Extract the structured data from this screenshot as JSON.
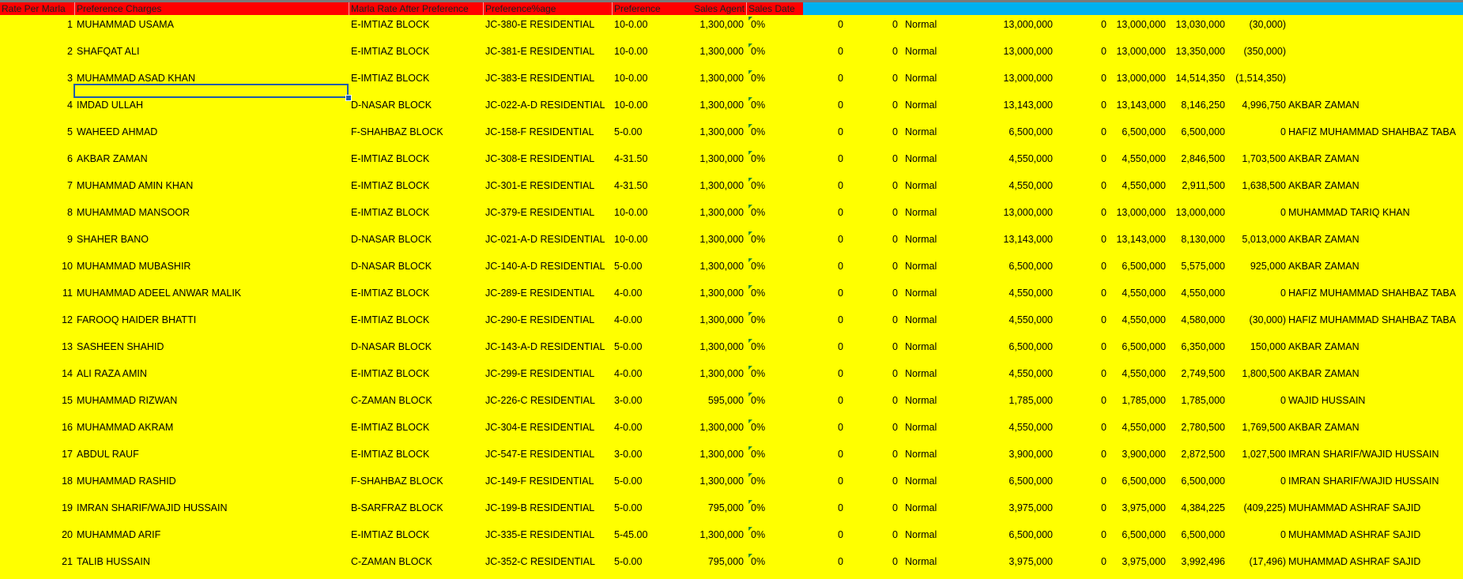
{
  "headers": [
    {
      "key": "rate_per_marla",
      "label": "Rate Per Marla"
    },
    {
      "key": "preference_charges",
      "label": "Preference Charges"
    },
    {
      "key": "marla_rate_after_preference",
      "label": "Marla Rate After Preference"
    },
    {
      "key": "preference_pct",
      "label": "Preference%age"
    },
    {
      "key": "preference",
      "label": "Preference"
    },
    {
      "key": "sales_agent",
      "label": "Sales Agent"
    },
    {
      "key": "sales_date",
      "label": "Sales Date"
    }
  ],
  "colors": {
    "header_red": "#ff0000",
    "header_blue": "#00b0f0",
    "row_fill": "#ffff00",
    "selection_border": "#1f5da8",
    "comment_marker": "#1e8a3a"
  },
  "comment_marker_icon": "comment-indicator-icon",
  "rows": [
    {
      "sr": "1",
      "name": "MUHAMMAD USAMA",
      "block": "E-IMTIAZ BLOCK",
      "plot": "JC-380-E RESIDENTIAL",
      "size": "10-0.00",
      "rate": "1,300,000",
      "pct": "0%",
      "c1": "0",
      "c2": "0",
      "status": "Normal",
      "total": "13,000,000",
      "c3": "0",
      "net": "13,000,000",
      "received": "13,030,000",
      "balance": "(30,000)",
      "agent": ""
    },
    {
      "sr": "2",
      "name": "SHAFQAT ALI",
      "block": "E-IMTIAZ BLOCK",
      "plot": "JC-381-E RESIDENTIAL",
      "size": "10-0.00",
      "rate": "1,300,000",
      "pct": "0%",
      "c1": "0",
      "c2": "0",
      "status": "Normal",
      "total": "13,000,000",
      "c3": "0",
      "net": "13,000,000",
      "received": "13,350,000",
      "balance": "(350,000)",
      "agent": ""
    },
    {
      "sr": "3",
      "name": "MUHAMMAD ASAD KHAN",
      "block": "E-IMTIAZ BLOCK",
      "plot": "JC-383-E RESIDENTIAL",
      "size": "10-0.00",
      "rate": "1,300,000",
      "pct": "0%",
      "c1": "0",
      "c2": "0",
      "status": "Normal",
      "total": "13,000,000",
      "c3": "0",
      "net": "13,000,000",
      "received": "14,514,350",
      "balance": "(1,514,350)",
      "agent": ""
    },
    {
      "sr": "4",
      "name": "IMDAD ULLAH",
      "block": "D-NASAR BLOCK",
      "plot": "JC-022-A-D RESIDENTIAL",
      "size": "10-0.00",
      "rate": "1,300,000",
      "pct": "0%",
      "c1": "0",
      "c2": "0",
      "status": "Normal",
      "total": "13,143,000",
      "c3": "0",
      "net": "13,143,000",
      "received": "8,146,250",
      "balance": "4,996,750",
      "agent": "AKBAR ZAMAN"
    },
    {
      "sr": "5",
      "name": "WAHEED AHMAD",
      "block": "F-SHAHBAZ BLOCK",
      "plot": "JC-158-F RESIDENTIAL",
      "size": "5-0.00",
      "rate": "1,300,000",
      "pct": "0%",
      "c1": "0",
      "c2": "0",
      "status": "Normal",
      "total": "6,500,000",
      "c3": "0",
      "net": "6,500,000",
      "received": "6,500,000",
      "balance": "0",
      "agent": "HAFIZ MUHAMMAD SHAHBAZ TABA"
    },
    {
      "sr": "6",
      "name": "AKBAR ZAMAN",
      "block": "E-IMTIAZ BLOCK",
      "plot": "JC-308-E RESIDENTIAL",
      "size": "4-31.50",
      "rate": "1,300,000",
      "pct": "0%",
      "c1": "0",
      "c2": "0",
      "status": "Normal",
      "total": "4,550,000",
      "c3": "0",
      "net": "4,550,000",
      "received": "2,846,500",
      "balance": "1,703,500",
      "agent": "AKBAR ZAMAN"
    },
    {
      "sr": "7",
      "name": "MUHAMMAD AMIN KHAN",
      "block": "E-IMTIAZ BLOCK",
      "plot": "JC-301-E RESIDENTIAL",
      "size": "4-31.50",
      "rate": "1,300,000",
      "pct": "0%",
      "c1": "0",
      "c2": "0",
      "status": "Normal",
      "total": "4,550,000",
      "c3": "0",
      "net": "4,550,000",
      "received": "2,911,500",
      "balance": "1,638,500",
      "agent": "AKBAR ZAMAN"
    },
    {
      "sr": "8",
      "name": "MUHAMMAD MANSOOR",
      "block": "E-IMTIAZ BLOCK",
      "plot": "JC-379-E RESIDENTIAL",
      "size": "10-0.00",
      "rate": "1,300,000",
      "pct": "0%",
      "c1": "0",
      "c2": "0",
      "status": "Normal",
      "total": "13,000,000",
      "c3": "0",
      "net": "13,000,000",
      "received": "13,000,000",
      "balance": "0",
      "agent": "MUHAMMAD TARIQ KHAN"
    },
    {
      "sr": "9",
      "name": "SHAHER BANO",
      "block": "D-NASAR BLOCK",
      "plot": "JC-021-A-D RESIDENTIAL",
      "size": "10-0.00",
      "rate": "1,300,000",
      "pct": "0%",
      "c1": "0",
      "c2": "0",
      "status": "Normal",
      "total": "13,143,000",
      "c3": "0",
      "net": "13,143,000",
      "received": "8,130,000",
      "balance": "5,013,000",
      "agent": "AKBAR ZAMAN"
    },
    {
      "sr": "10",
      "name": "MUHAMMAD MUBASHIR",
      "block": "D-NASAR BLOCK",
      "plot": "JC-140-A-D RESIDENTIAL",
      "size": "5-0.00",
      "rate": "1,300,000",
      "pct": "0%",
      "c1": "0",
      "c2": "0",
      "status": "Normal",
      "total": "6,500,000",
      "c3": "0",
      "net": "6,500,000",
      "received": "5,575,000",
      "balance": "925,000",
      "agent": "AKBAR ZAMAN"
    },
    {
      "sr": "11",
      "name": "MUHAMMAD ADEEL ANWAR MALIK",
      "block": "E-IMTIAZ BLOCK",
      "plot": "JC-289-E RESIDENTIAL",
      "size": "4-0.00",
      "rate": "1,300,000",
      "pct": "0%",
      "c1": "0",
      "c2": "0",
      "status": "Normal",
      "total": "4,550,000",
      "c3": "0",
      "net": "4,550,000",
      "received": "4,550,000",
      "balance": "0",
      "agent": "HAFIZ MUHAMMAD SHAHBAZ TABA"
    },
    {
      "sr": "12",
      "name": "FAROOQ HAIDER BHATTI",
      "block": "E-IMTIAZ BLOCK",
      "plot": "JC-290-E RESIDENTIAL",
      "size": "4-0.00",
      "rate": "1,300,000",
      "pct": "0%",
      "c1": "0",
      "c2": "0",
      "status": "Normal",
      "total": "4,550,000",
      "c3": "0",
      "net": "4,550,000",
      "received": "4,580,000",
      "balance": "(30,000)",
      "agent": "HAFIZ MUHAMMAD SHAHBAZ TABA"
    },
    {
      "sr": "13",
      "name": "SASHEEN SHAHID",
      "block": "D-NASAR BLOCK",
      "plot": "JC-143-A-D RESIDENTIAL",
      "size": "5-0.00",
      "rate": "1,300,000",
      "pct": "0%",
      "c1": "0",
      "c2": "0",
      "status": "Normal",
      "total": "6,500,000",
      "c3": "0",
      "net": "6,500,000",
      "received": "6,350,000",
      "balance": "150,000",
      "agent": "AKBAR ZAMAN"
    },
    {
      "sr": "14",
      "name": "ALI RAZA AMIN",
      "block": "E-IMTIAZ BLOCK",
      "plot": "JC-299-E RESIDENTIAL",
      "size": "4-0.00",
      "rate": "1,300,000",
      "pct": "0%",
      "c1": "0",
      "c2": "0",
      "status": "Normal",
      "total": "4,550,000",
      "c3": "0",
      "net": "4,550,000",
      "received": "2,749,500",
      "balance": "1,800,500",
      "agent": "AKBAR ZAMAN"
    },
    {
      "sr": "15",
      "name": "MUHAMMAD RIZWAN",
      "block": "C-ZAMAN BLOCK",
      "plot": "JC-226-C RESIDENTIAL",
      "size": "3-0.00",
      "rate": "595,000",
      "pct": "0%",
      "c1": "0",
      "c2": "0",
      "status": "Normal",
      "total": "1,785,000",
      "c3": "0",
      "net": "1,785,000",
      "received": "1,785,000",
      "balance": "0",
      "agent": "WAJID HUSSAIN"
    },
    {
      "sr": "16",
      "name": "MUHAMMAD AKRAM",
      "block": "E-IMTIAZ BLOCK",
      "plot": "JC-304-E RESIDENTIAL",
      "size": "4-0.00",
      "rate": "1,300,000",
      "pct": "0%",
      "c1": "0",
      "c2": "0",
      "status": "Normal",
      "total": "4,550,000",
      "c3": "0",
      "net": "4,550,000",
      "received": "2,780,500",
      "balance": "1,769,500",
      "agent": "AKBAR ZAMAN"
    },
    {
      "sr": "17",
      "name": "ABDUL RAUF",
      "block": "E-IMTIAZ BLOCK",
      "plot": "JC-547-E RESIDENTIAL",
      "size": "3-0.00",
      "rate": "1,300,000",
      "pct": "0%",
      "c1": "0",
      "c2": "0",
      "status": "Normal",
      "total": "3,900,000",
      "c3": "0",
      "net": "3,900,000",
      "received": "2,872,500",
      "balance": "1,027,500",
      "agent": "IMRAN SHARIF/WAJID HUSSAIN"
    },
    {
      "sr": "18",
      "name": "MUHAMMAD RASHID",
      "block": "F-SHAHBAZ BLOCK",
      "plot": "JC-149-F RESIDENTIAL",
      "size": "5-0.00",
      "rate": "1,300,000",
      "pct": "0%",
      "c1": "0",
      "c2": "0",
      "status": "Normal",
      "total": "6,500,000",
      "c3": "0",
      "net": "6,500,000",
      "received": "6,500,000",
      "balance": "0",
      "agent": "IMRAN SHARIF/WAJID HUSSAIN"
    },
    {
      "sr": "19",
      "name": "IMRAN SHARIF/WAJID HUSSAIN",
      "block": "B-SARFRAZ BLOCK",
      "plot": "JC-199-B RESIDENTIAL",
      "size": "5-0.00",
      "rate": "795,000",
      "pct": "0%",
      "c1": "0",
      "c2": "0",
      "status": "Normal",
      "total": "3,975,000",
      "c3": "0",
      "net": "3,975,000",
      "received": "4,384,225",
      "balance": "(409,225)",
      "agent": "MUHAMMAD ASHRAF SAJID"
    },
    {
      "sr": "20",
      "name": "MUHAMMAD ARIF",
      "block": "E-IMTIAZ BLOCK",
      "plot": "JC-335-E RESIDENTIAL",
      "size": "5-45.00",
      "rate": "1,300,000",
      "pct": "0%",
      "c1": "0",
      "c2": "0",
      "status": "Normal",
      "total": "6,500,000",
      "c3": "0",
      "net": "6,500,000",
      "received": "6,500,000",
      "balance": "0",
      "agent": "MUHAMMAD ASHRAF SAJID"
    },
    {
      "sr": "21",
      "name": "TALIB HUSSAIN",
      "block": "C-ZAMAN BLOCK",
      "plot": "JC-352-C RESIDENTIAL",
      "size": "5-0.00",
      "rate": "795,000",
      "pct": "0%",
      "c1": "0",
      "c2": "0",
      "status": "Normal",
      "total": "3,975,000",
      "c3": "0",
      "net": "3,975,000",
      "received": "3,992,496",
      "balance": "(17,496)",
      "agent": "MUHAMMAD ASHRAF SAJID"
    }
  ]
}
